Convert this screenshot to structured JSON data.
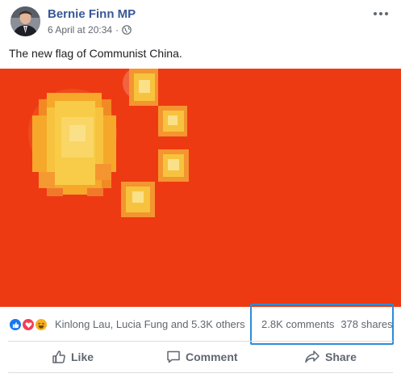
{
  "post": {
    "author": "Bernie Finn MP",
    "timestamp": "6 April at 20:34",
    "separator": "·",
    "caption": "The new flag of Communist China.",
    "privacy_icon": "globe-icon",
    "menu_icon": "more-icon"
  },
  "image": {
    "description_colors": {
      "background": "#ee3a12",
      "stars": "#f5c33b"
    }
  },
  "engagement": {
    "reaction_icons": [
      "like-reaction",
      "love-reaction",
      "haha-reaction"
    ],
    "reactors_text": "Kinlong Lau, Lucia Fung and 5.3K others",
    "comments": "2.8K comments",
    "shares": "378 shares"
  },
  "actions": {
    "like": "Like",
    "comment": "Comment",
    "share": "Share"
  },
  "colors": {
    "author_link": "#385898",
    "highlight_box": "#2e8bd6",
    "like_blue": "#1877f2",
    "love_red": "#f33e58",
    "haha_yellow": "#f7b125"
  }
}
